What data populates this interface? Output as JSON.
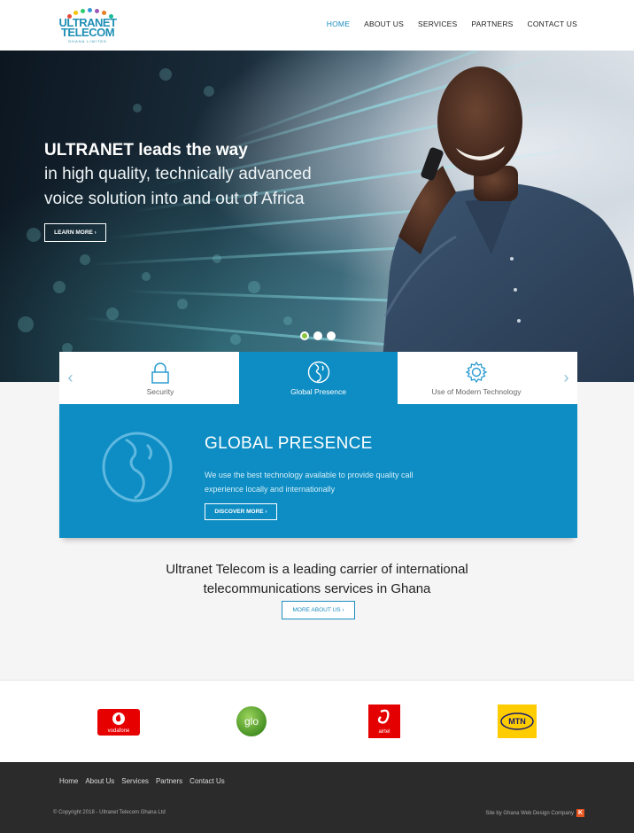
{
  "brand": {
    "name_line1": "ULTRANET",
    "name_line2": "TELECOM",
    "tagline": "GHANA LIMITED",
    "dot_colors": [
      "#e74c3c",
      "#f1c40f",
      "#2ecc71",
      "#3498db",
      "#9b59b6",
      "#e67e22",
      "#1abc9c"
    ]
  },
  "nav": {
    "items": [
      {
        "label": "HOME",
        "active": true
      },
      {
        "label": "ABOUT US",
        "active": false
      },
      {
        "label": "SERVICES",
        "active": false
      },
      {
        "label": "PARTNERS",
        "active": false
      },
      {
        "label": "CONTACT US",
        "active": false
      }
    ]
  },
  "hero": {
    "title": "ULTRANET leads the way",
    "subtitle_line1": "in high quality, technically advanced",
    "subtitle_line2": "voice solution into and out of Africa",
    "button_label": "LEARN MORE ›",
    "slides": 3,
    "active_slide": 1
  },
  "features": {
    "tabs": [
      {
        "label": "Security",
        "icon": "lock-icon",
        "active": false
      },
      {
        "label": "Global Presence",
        "icon": "globe-icon",
        "active": true
      },
      {
        "label": "Use of Modern Technology",
        "icon": "gear-icon",
        "active": false
      }
    ],
    "prev_arrow": "‹",
    "next_arrow": "›"
  },
  "panel": {
    "title": "GLOBAL PRESENCE",
    "description": "We use the best technology available to provide quality call experience locally and internationally",
    "button_label": "DISCOVER MORE ›"
  },
  "about": {
    "line1": "Ultranet Telecom is a leading carrier of international",
    "line2": "telecommunications services in Ghana",
    "button_label": "MORE ABOUT US ›"
  },
  "partners": {
    "logos": [
      {
        "name": "vodafone",
        "text": "vodafone",
        "color": "#e60000"
      },
      {
        "name": "glo",
        "text": "glo",
        "color": "#5aa02c"
      },
      {
        "name": "airtel",
        "text": "airtel",
        "color": "#e40000"
      },
      {
        "name": "mtn",
        "text": "MTN",
        "color": "#ffcc00"
      }
    ]
  },
  "footer": {
    "links": [
      "Home",
      "About Us",
      "Services",
      "Partners",
      "Contact Us"
    ],
    "copyright": "© Copyright 2018 - Ultranet Telecom Ghana Ltd",
    "credit": "Site by Ghana Web Design Company",
    "credit_mark": "K"
  },
  "colors": {
    "accent": "#0d8dc3",
    "nav_active": "#1d8dc0",
    "footer_bg": "#2b2b2b"
  }
}
